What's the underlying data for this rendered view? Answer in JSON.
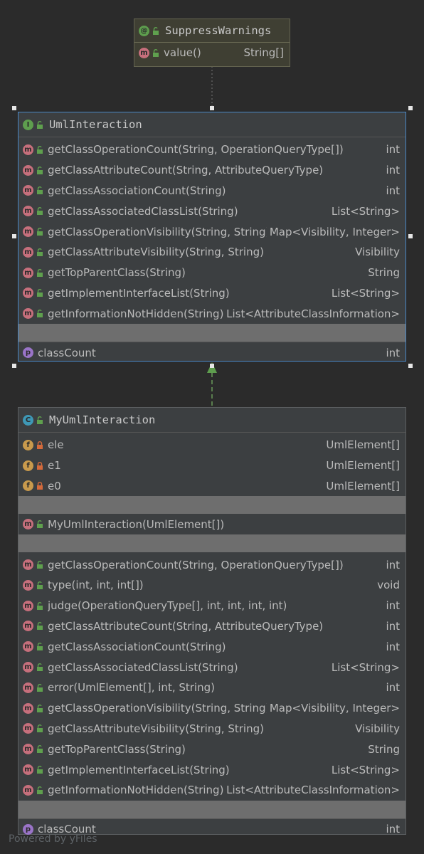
{
  "annotation": {
    "title": "SuppressWarnings",
    "title_icon": "annotation-icon",
    "members": [
      {
        "name": "value()",
        "type": "String[]",
        "kind": "m"
      }
    ]
  },
  "interface": {
    "title": "UmlInteraction",
    "title_icon": "interface-icon",
    "methods": [
      {
        "name": "getClassOperationCount(String, OperationQueryType[])",
        "type": "int"
      },
      {
        "name": "getClassAttributeCount(String, AttributeQueryType)",
        "type": "int"
      },
      {
        "name": "getClassAssociationCount(String)",
        "type": "int"
      },
      {
        "name": "getClassAssociatedClassList(String)",
        "type": "List<String>"
      },
      {
        "name": "getClassOperationVisibility(String, String)",
        "type": "Map<Visibility, Integer>"
      },
      {
        "name": "getClassAttributeVisibility(String, String)",
        "type": "Visibility"
      },
      {
        "name": "getTopParentClass(String)",
        "type": "String"
      },
      {
        "name": "getImplementInterfaceList(String)",
        "type": "List<String>"
      },
      {
        "name": "getInformationNotHidden(String)",
        "type": "List<AttributeClassInformation>"
      }
    ],
    "properties": [
      {
        "name": "classCount",
        "type": "int"
      }
    ]
  },
  "class": {
    "title": "MyUmlInteraction",
    "title_icon": "class-icon",
    "fields": [
      {
        "name": "ele",
        "type": "UmlElement[]"
      },
      {
        "name": "e1",
        "type": "UmlElement[]"
      },
      {
        "name": "e0",
        "type": "UmlElement[]"
      }
    ],
    "constructors": [
      {
        "name": "MyUmlInteraction(UmlElement[])",
        "type": ""
      }
    ],
    "methods": [
      {
        "name": "getClassOperationCount(String, OperationQueryType[])",
        "type": "int"
      },
      {
        "name": "type(int, int, int[])",
        "type": "void"
      },
      {
        "name": "judge(OperationQueryType[], int, int, int, int)",
        "type": "int"
      },
      {
        "name": "getClassAttributeCount(String, AttributeQueryType)",
        "type": "int"
      },
      {
        "name": "getClassAssociationCount(String)",
        "type": "int"
      },
      {
        "name": "getClassAssociatedClassList(String)",
        "type": "List<String>"
      },
      {
        "name": "error(UmlElement[], int, String)",
        "type": "int"
      },
      {
        "name": "getClassOperationVisibility(String, String)",
        "type": "Map<Visibility, Integer>"
      },
      {
        "name": "getClassAttributeVisibility(String, String)",
        "type": "Visibility"
      },
      {
        "name": "getTopParentClass(String)",
        "type": "String"
      },
      {
        "name": "getImplementInterfaceList(String)",
        "type": "List<String>"
      },
      {
        "name": "getInformationNotHidden(String)",
        "type": "List<AttributeClassInformation>"
      }
    ],
    "properties": [
      {
        "name": "classCount",
        "type": "int"
      }
    ]
  },
  "footer": "Powered by yFiles",
  "colors": {
    "background": "#2b2b2b",
    "node": "#3c3f41",
    "selected_border": "#4a88c7",
    "method_badge": "#c66f7c",
    "field_badge": "#c99a4c",
    "property_badge": "#9a74c8",
    "interface_badge": "#5e9e4e",
    "class_badge": "#3e98b6",
    "public_lock": "#5fa04e",
    "private_lock": "#d46a3c"
  }
}
